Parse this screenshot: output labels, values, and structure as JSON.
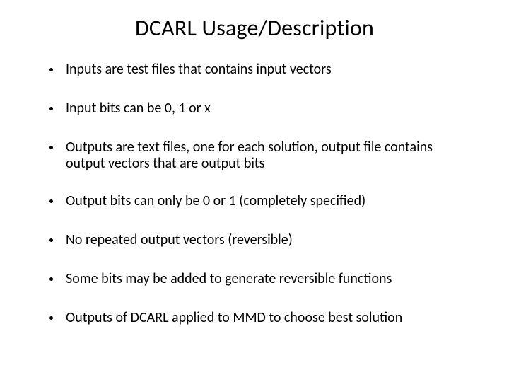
{
  "title": "DCARL Usage/Description",
  "bullets": [
    "Inputs are test files that contains input vectors",
    "Input bits can be 0, 1 or x",
    "Outputs are text files, one for each solution, output file contains output vectors that are output bits",
    "Output bits can only be 0 or 1 (completely specified)",
    "No repeated output vectors (reversible)",
    "Some bits may be added to generate reversible functions",
    "Outputs of DCARL applied to MMD to choose best solution"
  ]
}
